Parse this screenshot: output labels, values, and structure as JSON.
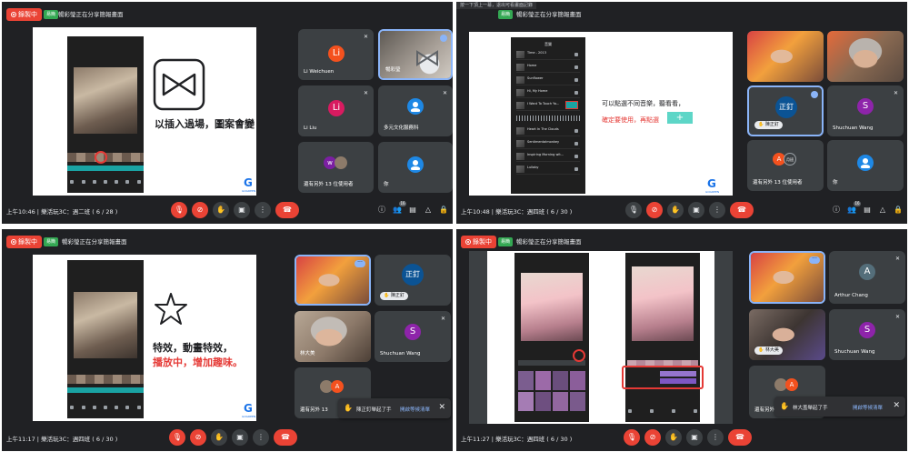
{
  "colors": {
    "meet_bg": "#202124",
    "tile_bg": "#3c4043",
    "record_red": "#ea4335",
    "accent_blue": "#8ab4f8",
    "annotation_red": "#e53935",
    "present_green": "#34a853"
  },
  "common": {
    "record_label": "錄製中",
    "present_badge": "易簡",
    "present_text": "暢彩瑩正在分享簡報畫面",
    "logo_letter": "G",
    "logo_sub": "GOGREEN",
    "you_label": "你",
    "others_label": "還有另外 13 位使用者",
    "raise_hand_label": "陳正釘",
    "toast_action": "開啟等候清單",
    "participant_count": "16",
    "chat_count": "",
    "icons": [
      "info-icon",
      "people-icon",
      "chat-icon",
      "activities-icon",
      "lock-icon"
    ]
  },
  "q1": {
    "clock": "上午10:46",
    "meeting": "樂活玩3C：週二班 ( 6 / 28 )",
    "slide_text": "以插入過場，圖案會變",
    "tiles": [
      {
        "name": "Li Weichuen",
        "initial": "Li",
        "color": "#f4511e"
      },
      {
        "name": "暢彩瑩",
        "initial": "",
        "color": ""
      },
      {
        "name": "Li Liu",
        "initial": "Li",
        "color": "#d81b60"
      },
      {
        "name": "多元文化服務科",
        "initial": "",
        "color": "#1e88e5"
      },
      {
        "name": "還有另外 13 位使用者",
        "initial": "w",
        "color": "#7b1fa2"
      },
      {
        "name": "你",
        "initial": "",
        "color": "#1e88e5"
      }
    ]
  },
  "q2": {
    "hint": "按一下頂上一幕，退出可看畫面記錄",
    "clock": "上午10:48",
    "meeting": "樂活玩3C：週四班 ( 6 / 30 )",
    "slide_text_1": "可以點選不同音樂，聽看看，",
    "slide_text_2": "確定要使用，再點選",
    "music_header": "音樂",
    "music_titles": [
      "Time - 2013",
      "Home",
      "Sunflower",
      "Hi, My Home",
      "I Want To Touch Yo...",
      "Mirror - Aerosmith",
      "Heart In The Clouds",
      "Sentimentalmonkey",
      "Inspiring Morning wit...",
      "Lullaby"
    ],
    "tiles": [
      {
        "name": "",
        "initial": "",
        "color": ""
      },
      {
        "name": "",
        "initial": "",
        "color": ""
      },
      {
        "name": "陳正釘",
        "initial": "正釘",
        "color": "#0b5394"
      },
      {
        "name": "Shuchuan Wang",
        "initial": "S",
        "color": "#8e24aa"
      },
      {
        "name": "還有另外 13 位使用者",
        "initial": "A",
        "color": "#f4511e"
      },
      {
        "name": "你",
        "initial": "",
        "color": "#1e88e5"
      }
    ]
  },
  "q3": {
    "clock": "上午11:17",
    "meeting": "樂活玩3C：週四班 ( 6 / 30 )",
    "slide_text_1": "特效，動畫特效，",
    "slide_text_2": "播放中，增加趣味。",
    "toast_msg": "陳正釘舉起了手",
    "tiles": [
      {
        "name": "",
        "initial": "",
        "color": ""
      },
      {
        "name": "陳正釘",
        "initial": "正釘",
        "color": "#0b5394"
      },
      {
        "name": "林大美",
        "initial": "",
        "color": ""
      },
      {
        "name": "Shuchuan Wang",
        "initial": "S",
        "color": "#8e24aa"
      },
      {
        "name": "還有另外 13",
        "initial": "A",
        "color": "#f4511e"
      },
      {
        "name": "",
        "initial": "",
        "color": "#1e88e5"
      }
    ]
  },
  "q4": {
    "clock": "上午11:27",
    "meeting": "樂活玩3C：週四班 ( 6 / 30 )",
    "toast_msg": "林大盖舉起了手",
    "tiles": [
      {
        "name": "",
        "initial": "",
        "color": ""
      },
      {
        "name": "Arthur Chang",
        "initial": "A",
        "color": "#546e7a"
      },
      {
        "name": "林大美",
        "initial": "",
        "color": ""
      },
      {
        "name": "Shuchuan Wang",
        "initial": "S",
        "color": "#8e24aa"
      },
      {
        "name": "還有另外 13 位使用者",
        "initial": "A",
        "color": "#f4511e"
      },
      {
        "name": "",
        "initial": "",
        "color": "#1e88e5"
      }
    ]
  }
}
